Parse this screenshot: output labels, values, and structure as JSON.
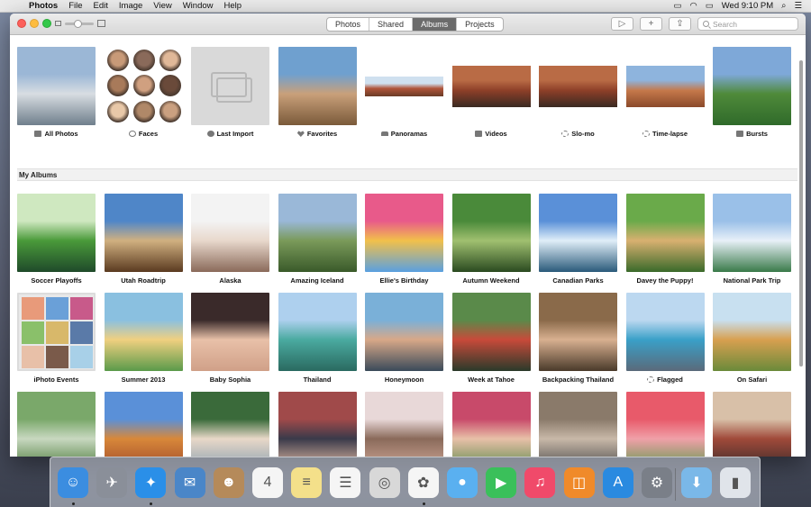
{
  "menubar": {
    "app": "Photos",
    "items": [
      "File",
      "Edit",
      "Image",
      "View",
      "Window",
      "Help"
    ],
    "clock": "Wed 9:10 PM"
  },
  "toolbar": {
    "segments": [
      "Photos",
      "Shared",
      "Albums",
      "Projects"
    ],
    "active_segment": "Albums",
    "slideshow_icon": "play-icon",
    "add_icon": "plus-icon",
    "share_icon": "share-icon",
    "search_placeholder": "Search"
  },
  "top_albums": [
    {
      "label": "All Photos",
      "icon": "album-icon",
      "colors": [
        "#9bb7d6",
        "#d8dde2",
        "#6f7f8c"
      ]
    },
    {
      "label": "Faces",
      "icon": "person-icon"
    },
    {
      "label": "Last Import",
      "icon": "clock-icon",
      "colors": [
        "#d6d6d6",
        "#d6d6d6",
        "#c9c9c9"
      ]
    },
    {
      "label": "Favorites",
      "icon": "heart-icon",
      "colors": [
        "#6fa0cf",
        "#c9a07a",
        "#7a5a3a"
      ]
    },
    {
      "label": "Panoramas",
      "icon": "panorama-icon",
      "colors": [
        "#cfe0ef",
        "#b0553a",
        "#6a3b26"
      ]
    },
    {
      "label": "Videos",
      "icon": "video-icon",
      "colors": [
        "#b96b45",
        "#8d3f28",
        "#3a2a22"
      ]
    },
    {
      "label": "Slo-mo",
      "icon": "slomo-icon",
      "colors": [
        "#b96b45",
        "#8d3f28",
        "#3a2a22"
      ]
    },
    {
      "label": "Time-lapse",
      "icon": "timelapse-icon",
      "colors": [
        "#8eb4dd",
        "#c5784a",
        "#8b4a2b"
      ]
    },
    {
      "label": "Bursts",
      "icon": "bursts-icon",
      "colors": [
        "#7ea8d8",
        "#4f8a3a",
        "#2f6a2a"
      ]
    }
  ],
  "section_title": "My Albums",
  "albums": [
    {
      "label": "Soccer Playoffs",
      "colors": [
        "#cfe8c0",
        "#4a9a3a",
        "#1f4a2a"
      ]
    },
    {
      "label": "Utah Roadtrip",
      "colors": [
        "#4f86c8",
        "#d0b080",
        "#5a3a20"
      ]
    },
    {
      "label": "Alaska",
      "colors": [
        "#f3f3f3",
        "#e8d8cc",
        "#8a6a5a"
      ]
    },
    {
      "label": "Amazing Iceland",
      "colors": [
        "#9ab8d8",
        "#7a9a5a",
        "#3a5a2a"
      ]
    },
    {
      "label": "Ellie's Birthday",
      "colors": [
        "#e85a8a",
        "#f2c04a",
        "#5aa0e0"
      ]
    },
    {
      "label": "Autumn Weekend",
      "colors": [
        "#4a8a3a",
        "#a0c070",
        "#2a4a20"
      ]
    },
    {
      "label": "Canadian Parks",
      "colors": [
        "#5a90d8",
        "#e0eef8",
        "#2a5a7a"
      ]
    },
    {
      "label": "Davey the Puppy!",
      "colors": [
        "#6aaa4a",
        "#d8b070",
        "#3a6a2a"
      ]
    },
    {
      "label": "National Park Trip",
      "colors": [
        "#9ac0e8",
        "#e8f0f8",
        "#3a7a4a"
      ]
    },
    {
      "label": "iPhoto Events",
      "colors": [
        "#e8a0b8",
        "#a0c0e0",
        "#d8d8d8"
      ]
    },
    {
      "label": "Summer 2013",
      "colors": [
        "#8ac0e0",
        "#f0d080",
        "#5a9a4a"
      ]
    },
    {
      "label": "Baby Sophia",
      "colors": [
        "#3a2a2a",
        "#e8c0a8",
        "#d0a088"
      ]
    },
    {
      "label": "Thailand",
      "colors": [
        "#aed0ee",
        "#4aaaa0",
        "#2a6a60"
      ]
    },
    {
      "label": "Honeymoon",
      "colors": [
        "#7ab0d8",
        "#d8a888",
        "#3a4a5a"
      ]
    },
    {
      "label": "Week at Tahoe",
      "colors": [
        "#5a8a4a",
        "#c84a3a",
        "#2a3a2a"
      ]
    },
    {
      "label": "Backpacking Thailand",
      "colors": [
        "#8a6a4a",
        "#d8b090",
        "#4a3a2a"
      ]
    },
    {
      "label": "Flagged",
      "icon": "gear-icon",
      "colors": [
        "#bcd8f0",
        "#3aa0c8",
        "#5a6a7a"
      ]
    },
    {
      "label": "On Safari",
      "colors": [
        "#c8e0f0",
        "#d8a050",
        "#6a8a3a"
      ]
    },
    {
      "label": "",
      "colors": [
        "#7aa86a",
        "#c8d8c0",
        "#4a7a3a"
      ]
    },
    {
      "label": "",
      "colors": [
        "#5a90d8",
        "#d8883a",
        "#a04a2a"
      ]
    },
    {
      "label": "",
      "colors": [
        "#3a6a3a",
        "#e8d8c8",
        "#8aa0b0"
      ]
    },
    {
      "label": "",
      "colors": [
        "#a04a4a",
        "#3a3a4a",
        "#e8c0a8"
      ]
    },
    {
      "label": "",
      "colors": [
        "#e8d8d8",
        "#8a6a5a",
        "#d0a898"
      ]
    },
    {
      "label": "",
      "colors": [
        "#c84a6a",
        "#e8c0a8",
        "#5a8a4a"
      ]
    },
    {
      "label": "",
      "colors": [
        "#8a7a6a",
        "#c8b8a8",
        "#4a4a4a"
      ]
    },
    {
      "label": "",
      "colors": [
        "#e85a6a",
        "#f0a0a8",
        "#5a9a4a"
      ]
    },
    {
      "label": "",
      "colors": [
        "#d8c0a8",
        "#a04a3a",
        "#3a2a2a"
      ]
    }
  ],
  "dock": [
    {
      "name": "finder-icon",
      "color": "#3b8de0",
      "glyph": "☺",
      "running": true
    },
    {
      "name": "launchpad-icon",
      "color": "#8a8f99",
      "glyph": "✈",
      "running": false
    },
    {
      "name": "safari-icon",
      "color": "#2a8fe8",
      "glyph": "✦",
      "running": true
    },
    {
      "name": "mail-icon",
      "color": "#4a86c8",
      "glyph": "✉",
      "running": false
    },
    {
      "name": "contacts-icon",
      "color": "#b58a5a",
      "glyph": "☻",
      "running": false
    },
    {
      "name": "calendar-icon",
      "color": "#f5f5f5",
      "glyph": "4",
      "running": false
    },
    {
      "name": "notes-icon",
      "color": "#f4e08a",
      "glyph": "≡",
      "running": false
    },
    {
      "name": "reminders-icon",
      "color": "#f5f5f5",
      "glyph": "☰",
      "running": false
    },
    {
      "name": "preview-icon",
      "color": "#d8d8d8",
      "glyph": "◎",
      "running": false
    },
    {
      "name": "photos-icon",
      "color": "#f5f5f5",
      "glyph": "✿",
      "running": true
    },
    {
      "name": "messages-icon",
      "color": "#5ab0f0",
      "glyph": "●",
      "running": false
    },
    {
      "name": "facetime-icon",
      "color": "#3ac05a",
      "glyph": "▶",
      "running": false
    },
    {
      "name": "itunes-icon",
      "color": "#f04a6a",
      "glyph": "♫",
      "running": false
    },
    {
      "name": "ibooks-icon",
      "color": "#f08a2a",
      "glyph": "◫",
      "running": false
    },
    {
      "name": "appstore-icon",
      "color": "#2a8ae0",
      "glyph": "A",
      "running": false
    },
    {
      "name": "system-preferences-icon",
      "color": "#7a7f88",
      "glyph": "⚙",
      "running": false
    },
    {
      "name": "downloads-folder-icon",
      "color": "#7ab8e8",
      "glyph": "⬇",
      "running": false
    },
    {
      "name": "trash-icon",
      "color": "#e0e4ea",
      "glyph": "▮",
      "running": false
    }
  ]
}
